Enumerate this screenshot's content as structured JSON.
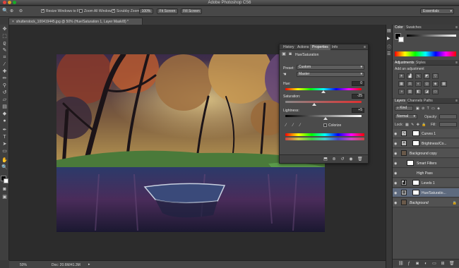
{
  "window": {
    "title": "Adobe Photoshop CS6"
  },
  "options_bar": {
    "resize_windows": "Resize Windows to Fit",
    "zoom_all": "Zoom All Windows",
    "scrubby_zoom": "Scrubby Zoom",
    "btn_100": "100%",
    "btn_fit": "Fit Screen",
    "btn_fill": "Fill Screen",
    "workspace": "Essentials"
  },
  "document": {
    "tab_label": "shutterstock_100419445.jpg @ 50% (Hue/Saturation 1, Layer Mask/8) *"
  },
  "status": {
    "zoom": "50%",
    "doc": "Doc: 20.6M/41.3M"
  },
  "properties": {
    "tabs": [
      "History",
      "Actions",
      "Properties",
      "Info"
    ],
    "header": "Hue/Saturation",
    "preset_label": "Preset:",
    "preset_value": "Custom",
    "channel_value": "Master",
    "hue_label": "Hue:",
    "hue_value": "0",
    "saturation_label": "Saturation:",
    "saturation_value": "-25",
    "lightness_label": "Lightness:",
    "lightness_value": "+5",
    "colorize_label": "Colorize",
    "hue_level": 0.5,
    "saturation_level": 0.375,
    "lightness_level": 0.525
  },
  "color_panel": {
    "tabs": [
      "Color",
      "Swatches"
    ]
  },
  "adjustments_panel": {
    "tabs": [
      "Adjustments",
      "Styles"
    ],
    "subtitle": "Add an adjustment"
  },
  "layers_panel": {
    "tabs": [
      "Layers",
      "Channels",
      "Paths"
    ],
    "kind_label": "Kind",
    "blend_mode": "Normal",
    "opacity_label": "Opacity:",
    "fill_label": "Fill:",
    "lock_label": "Lock:",
    "layers": [
      {
        "name": "Curves 1"
      },
      {
        "name": "Brightness/Co..."
      },
      {
        "name": "Background copy"
      },
      {
        "name": "Smart Filters"
      },
      {
        "name": "High Pass"
      },
      {
        "name": "Levels 1"
      },
      {
        "name": "Hue/Saturatio..."
      },
      {
        "name": "Background"
      }
    ]
  },
  "colors": {
    "accent": "#5e6a7e",
    "panel": "#4a4a4a",
    "canvas": "#2c2c2c"
  }
}
